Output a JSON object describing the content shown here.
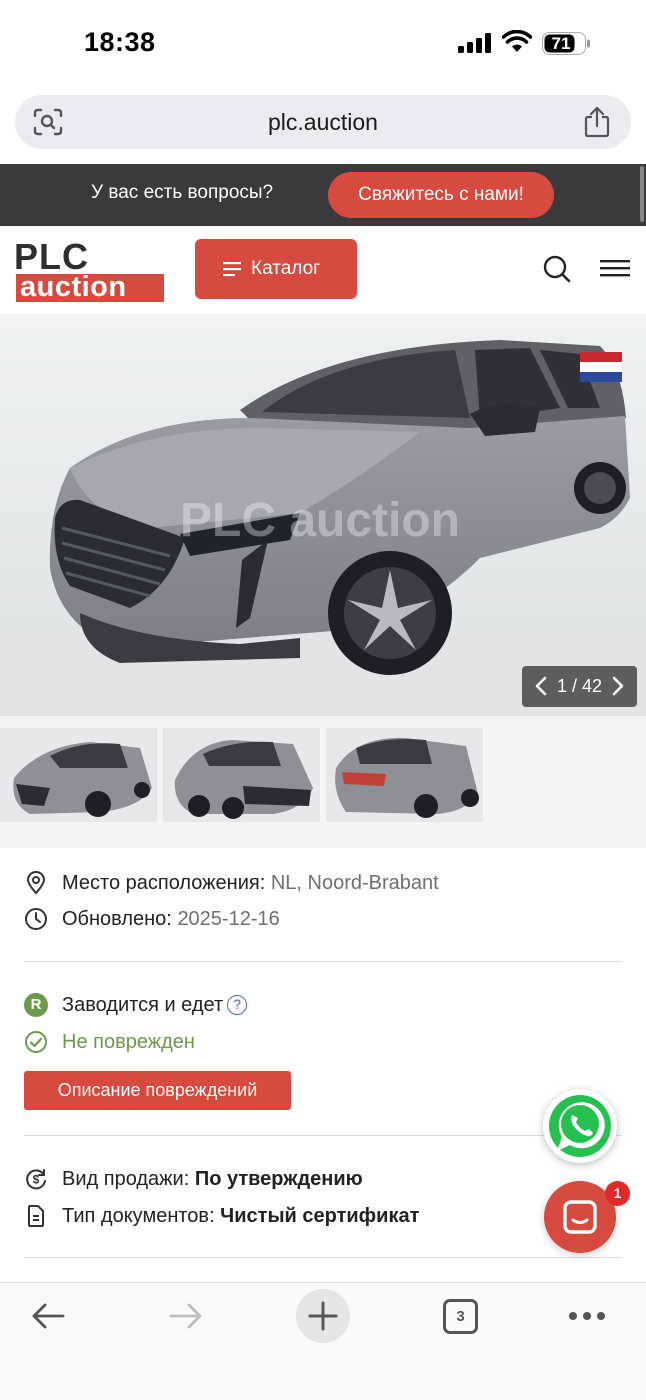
{
  "status_bar": {
    "time": "18:38",
    "battery": "71"
  },
  "browser": {
    "url": "plc.auction",
    "tabs_count": "3"
  },
  "banner": {
    "question": "У вас есть вопросы?",
    "contact_button": "Свяжитесь с нами!"
  },
  "header": {
    "logo_top": "PLC",
    "logo_bottom": "auction",
    "catalog_button": "Каталог"
  },
  "gallery": {
    "counter": "1 / 42",
    "watermark": "PLC auction"
  },
  "location": {
    "label": "Место расположения:",
    "value": "NL, Noord-Brabant"
  },
  "updated": {
    "label": "Обновлено:",
    "value": "2025-12-16"
  },
  "condition": {
    "runs_drives": "Заводится и едет",
    "runs_badge": "R",
    "help": "?",
    "damage_status": "Не поврежден",
    "damage_button": "Описание повреждений"
  },
  "sale": {
    "type_label": "Вид продажи:",
    "type_value": "По утверждению",
    "docs_label": "Тип документов:",
    "docs_value": "Чистый сертификат"
  },
  "chat": {
    "badge": "1"
  },
  "colors": {
    "accent": "#d64a3f",
    "banner": "#3a3a3c",
    "green": "#6b9a4a"
  }
}
